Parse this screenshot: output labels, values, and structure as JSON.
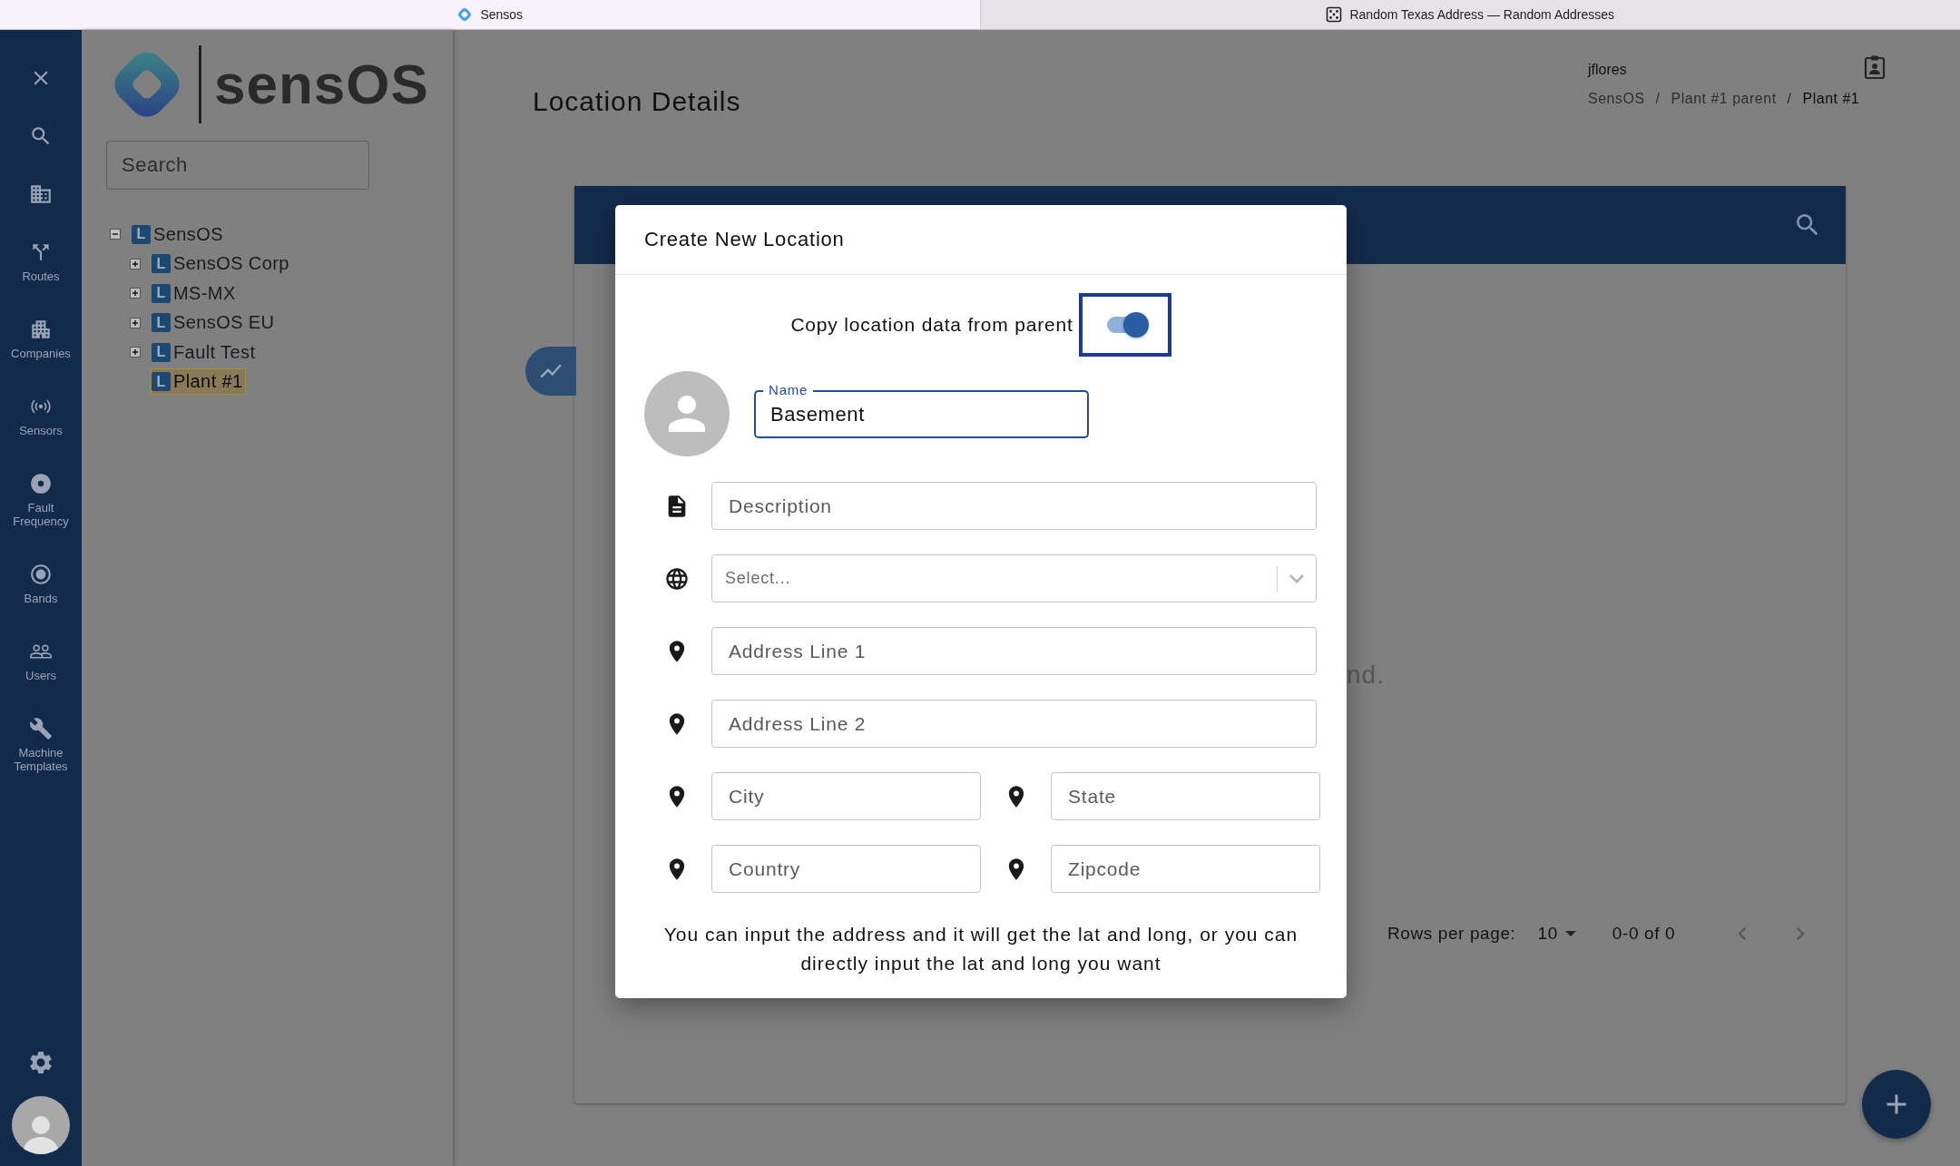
{
  "browser_tabs": [
    {
      "title": "Sensos",
      "selected": true
    },
    {
      "title": "Random Texas Address — Random Addresses",
      "selected": false
    }
  ],
  "nav": [
    {
      "kind": "close"
    },
    {
      "kind": "search"
    },
    {
      "kind": "buildings"
    },
    {
      "kind": "routes",
      "label": "Routes"
    },
    {
      "kind": "companies",
      "label": "Companies"
    },
    {
      "kind": "sensors",
      "label": "Sensors"
    },
    {
      "kind": "disc",
      "label": "Fault Frequency"
    },
    {
      "kind": "target",
      "label": "Bands"
    },
    {
      "kind": "users",
      "label": "Users"
    },
    {
      "kind": "wrench",
      "label": "Machine Templates"
    }
  ],
  "sidebar": {
    "logo": "sensOS",
    "search": {
      "placeholder": "Search"
    },
    "tree": [
      {
        "badge": "L",
        "label": "SensOS",
        "kind": "branch",
        "expanded": true,
        "selected": false,
        "children": [
          {
            "badge": "L",
            "label": "SensOS Corp",
            "kind": "branch",
            "expanded": false,
            "selected": false
          },
          {
            "badge": "L",
            "label": "MS-MX",
            "kind": "branch",
            "expanded": false,
            "selected": false
          },
          {
            "badge": "L",
            "label": "SensOS EU",
            "kind": "branch",
            "expanded": false,
            "selected": false
          },
          {
            "badge": "L",
            "label": "Fault Test",
            "kind": "branch",
            "expanded": false,
            "selected": false
          },
          {
            "badge": "L",
            "label": "Plant #1",
            "kind": "leaf",
            "selected": true
          }
        ]
      }
    ]
  },
  "header": {
    "title": "Location Details",
    "user": "jflores",
    "breadcrumbs": {
      "separator": "/",
      "items": [
        {
          "label": "SensOS",
          "current": false
        },
        {
          "label": "Plant #1 parent",
          "current": false
        },
        {
          "label": "Plant #1",
          "current": true
        }
      ]
    }
  },
  "table": {
    "empty_text": "nd.",
    "pagination": {
      "rows_label": "Rows per page:",
      "rows_value": "10",
      "range": "0-0 of 0"
    }
  },
  "dialog": {
    "title": "Create New Location",
    "copy_toggle": {
      "label": "Copy location data from parent",
      "on": true
    },
    "name_field": {
      "label": "Name",
      "value": "Basement"
    },
    "rows": [
      [
        {
          "kind": "note",
          "placeholder": "Description"
        }
      ],
      [
        {
          "kind": "select",
          "placeholder": "Select..."
        }
      ],
      [
        {
          "kind": "place",
          "placeholder": "Address Line 1"
        }
      ],
      [
        {
          "kind": "place",
          "placeholder": "Address Line 2"
        }
      ],
      [
        {
          "kind": "place",
          "placeholder": "City"
        },
        {
          "kind": "place",
          "placeholder": "State"
        }
      ],
      [
        {
          "kind": "place",
          "placeholder": "Country"
        },
        {
          "kind": "place",
          "placeholder": "Zipcode"
        }
      ]
    ],
    "note": "You can input the address and it will get the lat and long, or you can directly input the lat and long you want"
  }
}
